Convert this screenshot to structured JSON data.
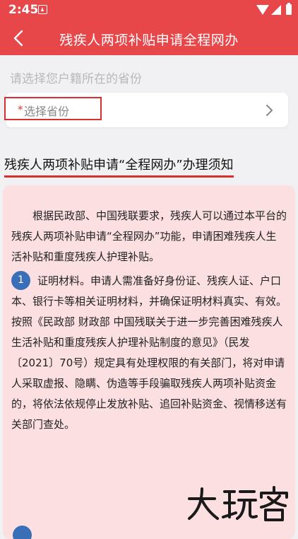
{
  "status_bar": {
    "time": "2:45"
  },
  "header": {
    "title": "残疾人两项补贴申请全程网办"
  },
  "province": {
    "section_hint": "请选择您户籍所在的省份",
    "required_mark": "*",
    "placeholder": "选择省份"
  },
  "notice": {
    "heading": "残疾人两项补贴申请“全程网办”办理须知",
    "intro": "根据民政部、中国残联要求，残疾人可以通过本平台的残疾人两项补贴申请“全程网办”功能，申请困难残疾人生活补贴和重度残疾人护理补贴。",
    "steps": [
      {
        "number": "1",
        "text": "证明材料。申请人需准备好身份证、残疾人证、户口本、银行卡等相关证明材料，并确保证明材料真实、有效。按照《民政部 财政部 中国残联关于进一步完善困难残疾人生活补贴和重度残疾人护理补贴制度的意见》（民发〔2021〕70号）规定具有处理权限的有关部门，将对申请人采取虚报、隐瞒、伪造等手段骗取残疾人两项补贴资金的，将依法依规停止发放补贴、追回补贴资金、视情移送有关部门查处。"
      }
    ]
  },
  "colors": {
    "brand_red": "#e8474a",
    "notice_bg": "#fcdfe1",
    "step_badge": "#3a6fb8"
  },
  "icons": {
    "back": "arrow-left-icon",
    "chevron": "chevron-right-icon",
    "wifi": "wifi-icon",
    "signal": "cell-signal-icon",
    "battery": "battery-icon",
    "app_notification": "notification-a-icon"
  }
}
